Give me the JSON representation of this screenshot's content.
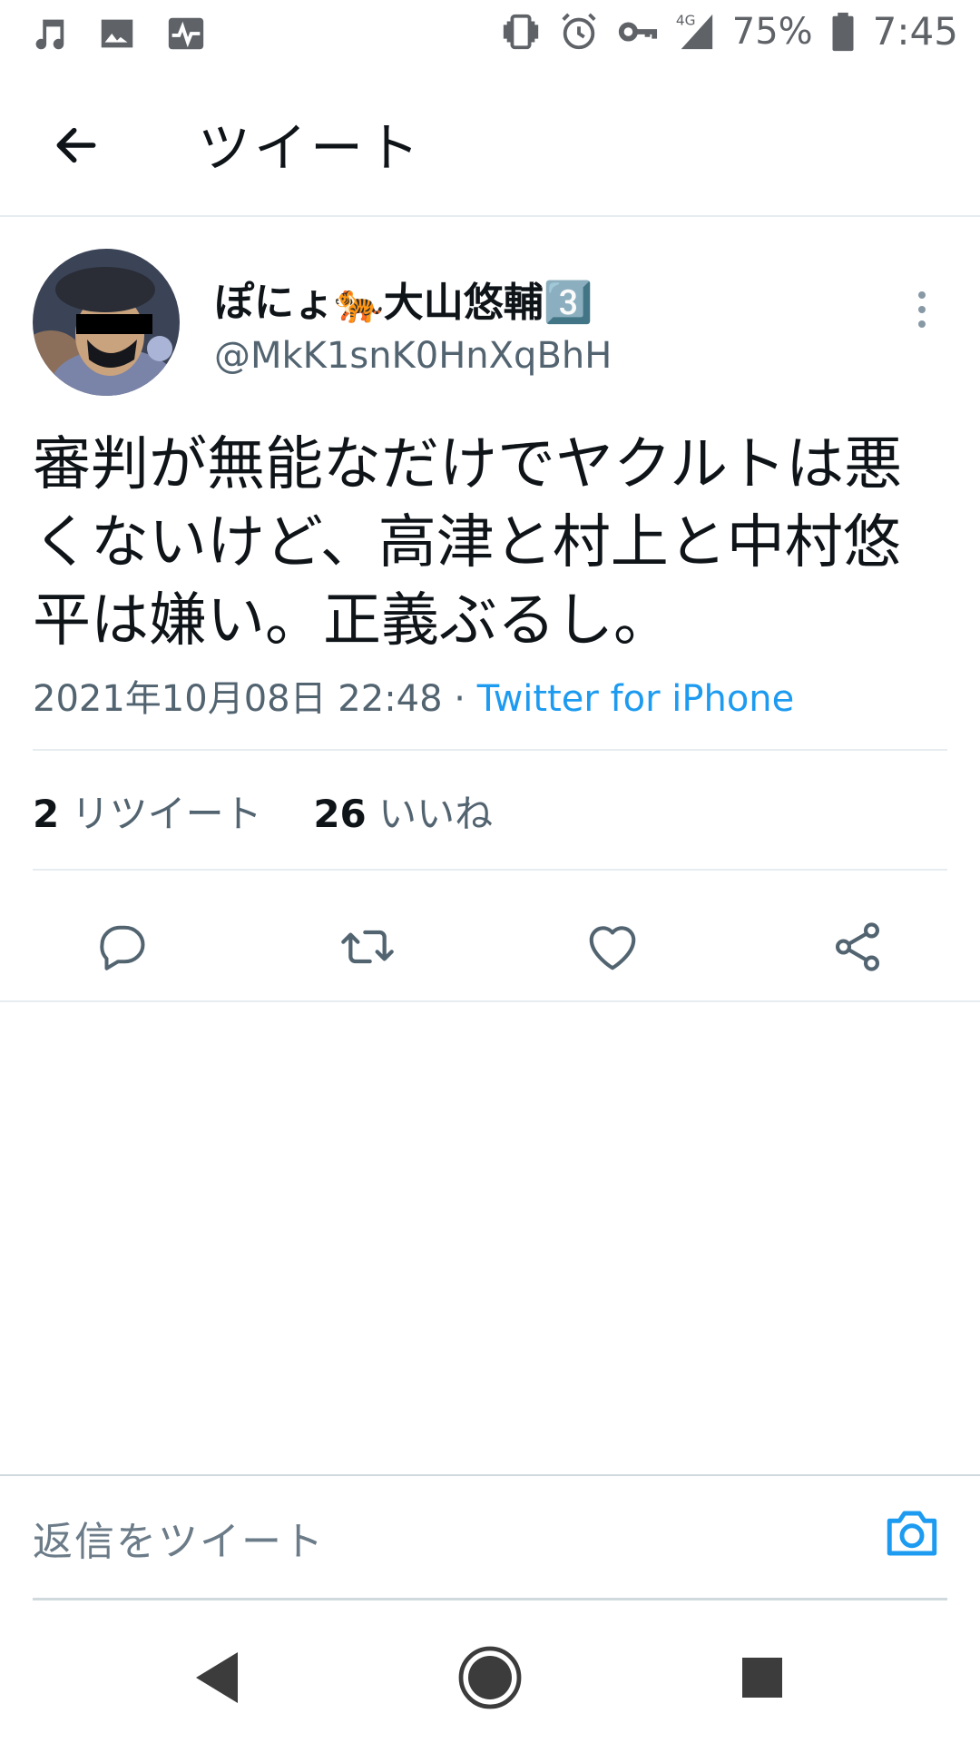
{
  "status_bar": {
    "left_icons": [
      "music-note-icon",
      "image-icon",
      "activity-icon"
    ],
    "right_icons": [
      "vibrate-icon",
      "alarm-icon",
      "vpn-key-icon",
      "signal-4g-icon",
      "battery-icon"
    ],
    "network": "4G",
    "battery": "75%",
    "time": "7:45"
  },
  "header": {
    "title": "ツイート",
    "back_icon": "arrow-left-icon"
  },
  "tweet": {
    "display_name": "ぽにょ🐅大山悠輔3️⃣",
    "username": "@MkK1snK0HnXqBhH",
    "text": "審判が無能なだけでヤクルトは悪くないけど、高津と村上と中村悠平は嫌い。正義ぶるし。",
    "timestamp": "2021年10月08日 22:48",
    "separator": " · ",
    "source": "Twitter for iPhone",
    "retweet_count": "2",
    "retweet_label": "リツイート",
    "like_count": "26",
    "like_label": "いいね",
    "more_icon": "more-vertical-icon",
    "actions": [
      "reply-icon",
      "retweet-icon",
      "like-icon",
      "share-icon"
    ]
  },
  "reply": {
    "placeholder": "返信をツイート",
    "camera_icon": "camera-icon"
  },
  "nav": [
    "back-triangle-icon",
    "home-circle-icon",
    "recents-square-icon"
  ],
  "colors": {
    "accent": "#1d9bf0",
    "secondary_text": "#536471",
    "divider": "#e6ecf0"
  }
}
